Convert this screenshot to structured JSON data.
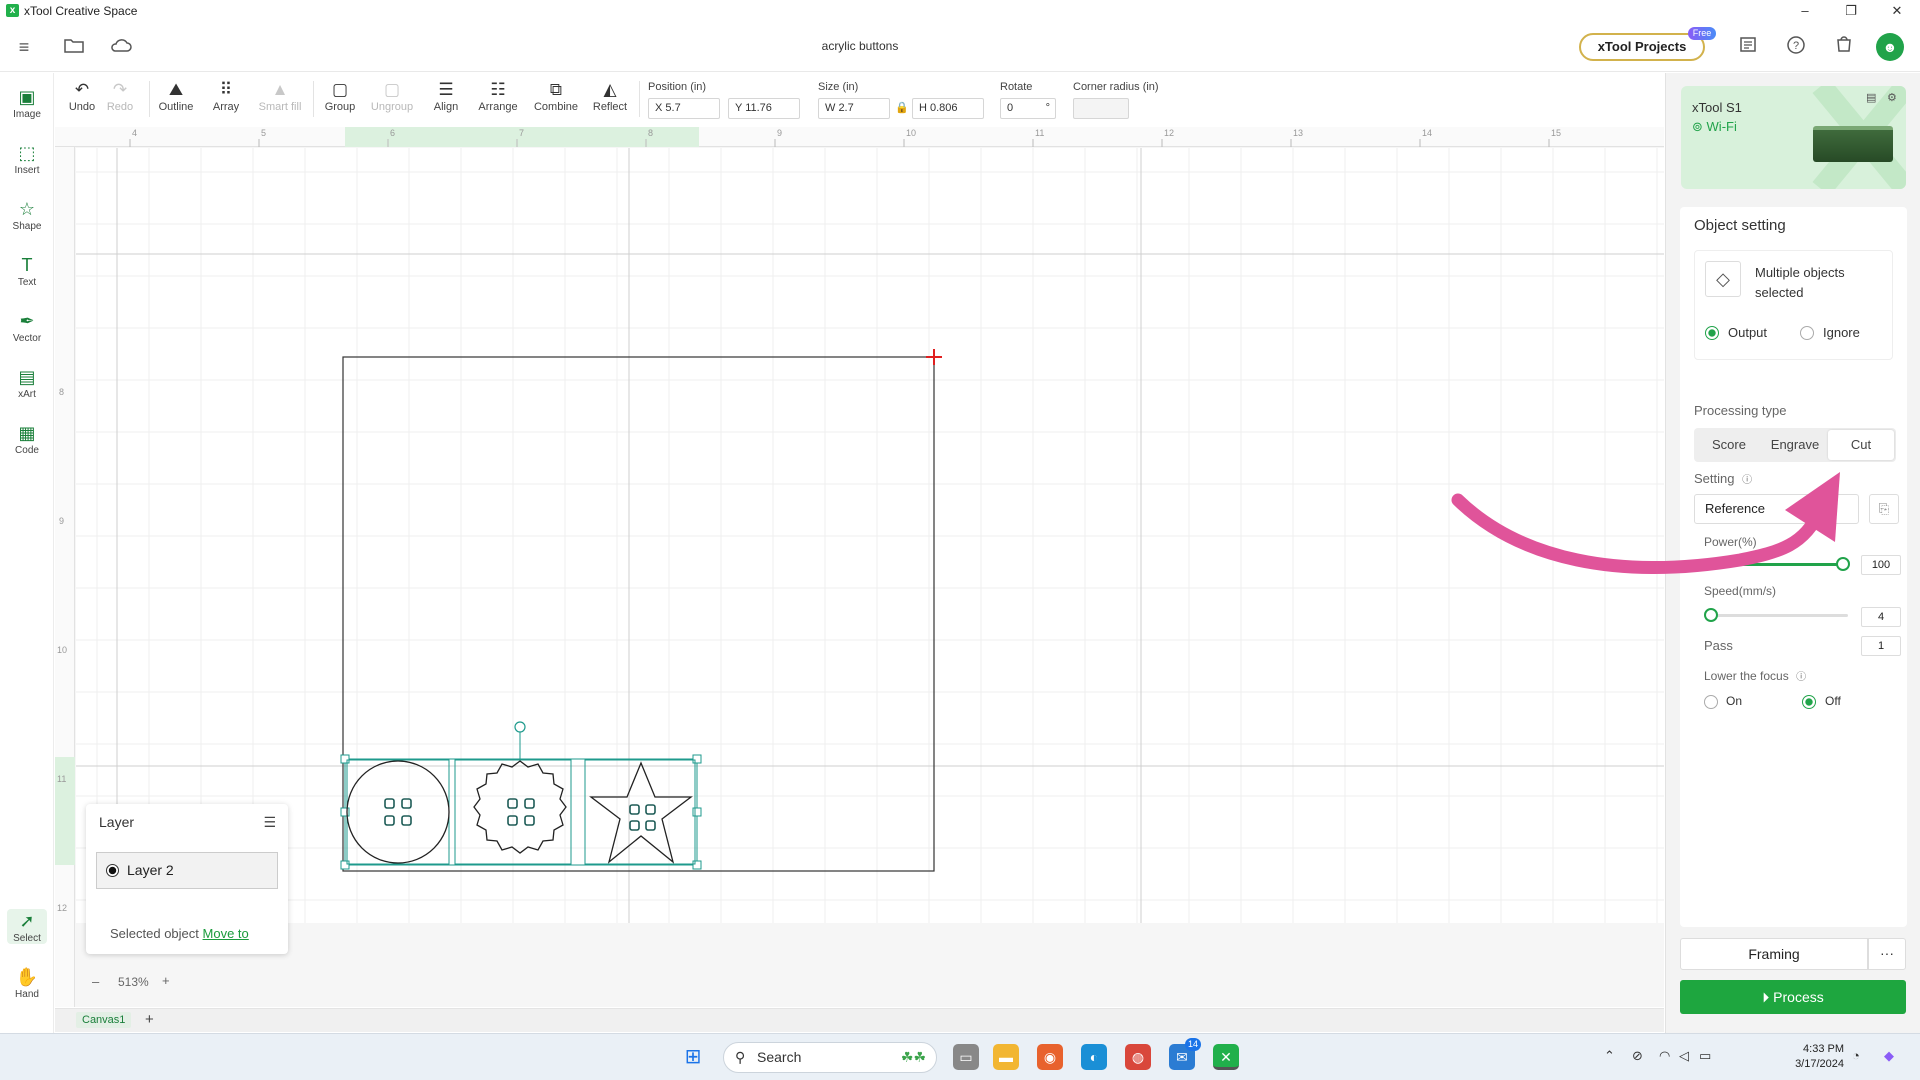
{
  "window": {
    "app_title": "xTool Creative Space",
    "controls": [
      "–",
      "❐",
      "✕"
    ]
  },
  "header": {
    "document_title": "acrylic buttons",
    "projects_button": "xTool Projects",
    "free_badge": "Free"
  },
  "left_tools": [
    {
      "label": "Image",
      "icon": "image-icon"
    },
    {
      "label": "Insert",
      "icon": "insert-icon"
    },
    {
      "label": "Shape",
      "icon": "shape-icon"
    },
    {
      "label": "Text",
      "icon": "text-icon"
    },
    {
      "label": "Vector",
      "icon": "pen-icon"
    },
    {
      "label": "xArt",
      "icon": "xart-icon"
    },
    {
      "label": "Code",
      "icon": "qrcode-icon"
    }
  ],
  "bottom_tools": [
    {
      "label": "Select",
      "icon": "cursor-icon",
      "active": true
    },
    {
      "label": "Hand",
      "icon": "hand-icon"
    }
  ],
  "toolbar": {
    "undo": "Undo",
    "redo": "Redo",
    "outline": "Outline",
    "array": "Array",
    "smart_fill": "Smart fill",
    "group": "Group",
    "ungroup": "Ungroup",
    "align": "Align",
    "arrange": "Arrange",
    "combine": "Combine",
    "reflect": "Reflect",
    "position_label": "Position (in)",
    "x_value": "X 5.7",
    "y_value": "Y 11.76",
    "size_label": "Size (in)",
    "w_value": "W 2.7",
    "h_value": "H 0.806",
    "rotate_label": "Rotate",
    "rotate_value": "0",
    "rotate_unit": "°",
    "corner_label": "Corner radius (in)",
    "corner_value": ""
  },
  "rulers": {
    "top": [
      "4",
      "5",
      "6",
      "7",
      "8",
      "9",
      "10",
      "11",
      "12",
      "13",
      "14",
      "15"
    ],
    "left": [
      "8",
      "9",
      "10",
      "11",
      "12"
    ]
  },
  "layer_panel": {
    "title": "Layer",
    "layer_name": "Layer 2",
    "selected_text": "Selected object",
    "move_to": "Move to"
  },
  "zoom": {
    "minus": "–",
    "value": "513%",
    "plus": "+"
  },
  "canvas_tabs": {
    "tab": "Canvas1",
    "add": "+"
  },
  "device": {
    "name": "xTool S1",
    "connection": "Wi-Fi"
  },
  "object_setting": {
    "title": "Object setting",
    "selection_text": "Multiple objects selected",
    "output_label": "Output",
    "ignore_label": "Ignore",
    "output_selected": true,
    "processing_type_label": "Processing type",
    "processing_types": [
      "Score",
      "Engrave",
      "Cut"
    ],
    "processing_selected": "Cut",
    "setting_label": "Setting",
    "setting_value": "Reference",
    "power_label": "Power(%)",
    "power_value": "100",
    "power_fraction": 1.0,
    "speed_label": "Speed(mm/s)",
    "speed_value": "4",
    "speed_fraction": 0.0,
    "pass_label": "Pass",
    "pass_value": "1",
    "lower_focus_label": "Lower the focus",
    "on_label": "On",
    "off_label": "Off",
    "lower_focus_selected": "Off"
  },
  "actions": {
    "framing": "Framing",
    "more": "···",
    "process": "Process"
  },
  "taskbar": {
    "search_placeholder": "Search",
    "time": "4:33 PM",
    "date": "3/17/2024",
    "badge": "14"
  },
  "colors": {
    "brand_green": "#1ea63f",
    "selection_teal": "#1e9a8c",
    "annotation_pink": "#e0549a"
  }
}
